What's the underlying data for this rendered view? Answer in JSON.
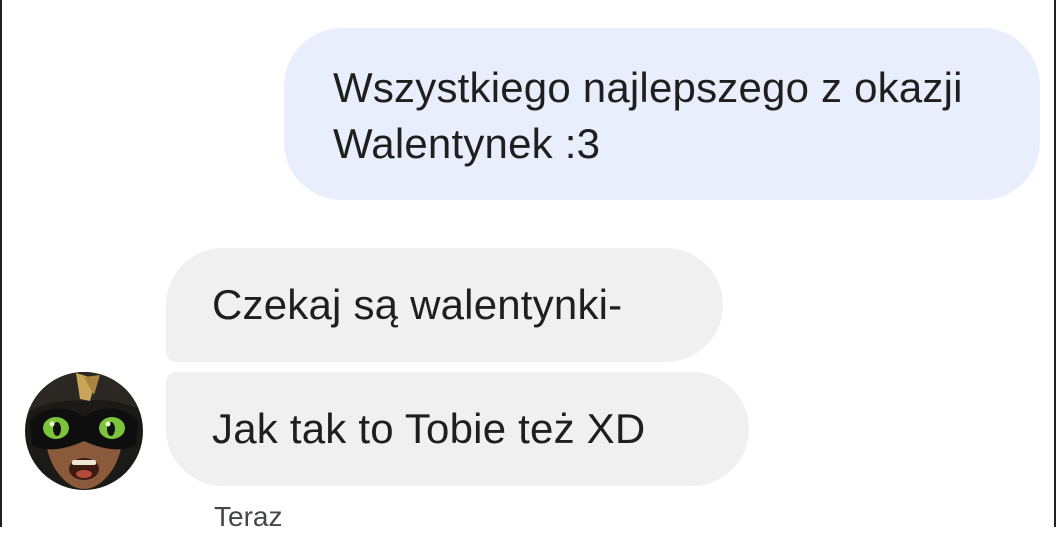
{
  "conversation": {
    "outgoing": [
      {
        "text": "Wszystkiego najlepszego z okazji Walentynek :3"
      }
    ],
    "incoming": [
      {
        "text": "Czekaj są walentynki-"
      },
      {
        "text": "Jak tak to Tobie też XD"
      }
    ],
    "timestamp": "Teraz",
    "avatar_icon": "cat-mask-avatar-icon"
  },
  "colors": {
    "outgoing_bubble": "#e8eefb",
    "incoming_bubble": "#f0f0f0",
    "text": "#1f1f1f",
    "timestamp": "#444746"
  }
}
